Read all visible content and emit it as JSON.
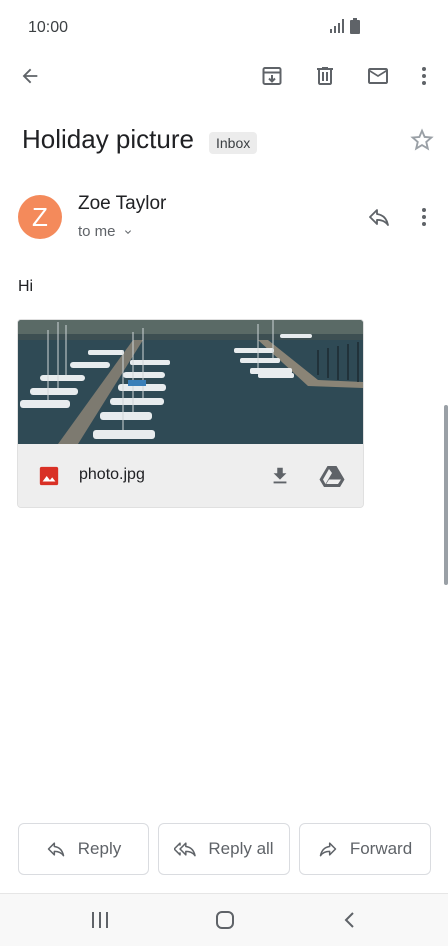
{
  "status": {
    "time": "10:00"
  },
  "toolbar": {
    "back_icon": "arrow-back-icon",
    "archive_icon": "archive-icon",
    "delete_icon": "delete-icon",
    "mark_unread_icon": "mail-icon",
    "more_icon": "more-vert-icon"
  },
  "email": {
    "subject": "Holiday picture",
    "label": "Inbox",
    "sender_initial": "Z",
    "sender_name": "Zoe Taylor",
    "recipient": "to me",
    "body": "Hi",
    "avatar_color": "#f48a5b"
  },
  "attachment": {
    "filename": "photo.jpg",
    "type_icon": "image-file-icon",
    "download_icon": "download-icon",
    "drive_icon": "google-drive-icon"
  },
  "actions": {
    "reply": "Reply",
    "reply_all": "Reply all",
    "forward": "Forward"
  }
}
